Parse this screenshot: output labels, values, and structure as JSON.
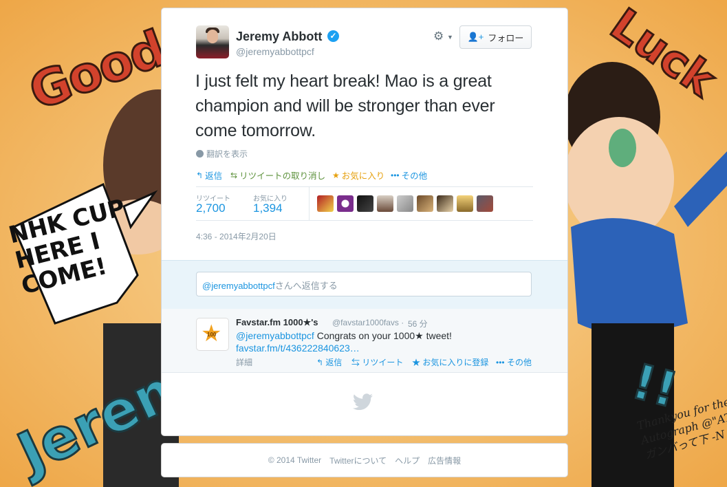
{
  "tweet": {
    "author_name": "Jeremy Abbott",
    "author_handle": "@jeremyabbottpcf",
    "follow_label": "フォロー",
    "text": "I just felt my heart break! Mao is a great champion and will be stronger than ever come tomorrow.",
    "translate_label": "翻訳を表示",
    "actions": {
      "reply": "返信",
      "retweet_undo": "リツイートの取り消し",
      "favorite": "お気に入り",
      "more": "その他"
    },
    "stats": {
      "retweets_label": "リツイート",
      "retweets_value": "2,700",
      "favorites_label": "お気に入り",
      "favorites_value": "1,394"
    },
    "timestamp": "4:36 - 2014年2月20日"
  },
  "reply_box": {
    "mention": "@jeremyabbottpcf",
    "suffix": "さんへ返信する"
  },
  "reply_tweet": {
    "author_name": "Favstar.fm 1000★'s",
    "author_handle": "@favstar1000favs",
    "separator": "·",
    "time": "56 分",
    "avatar_number": "100",
    "mention": "@jeremyabbottpcf",
    "body_text": " Congrats on your 1000★ tweet!",
    "link": "favstar.fm/t/436222840623…",
    "details": "詳細",
    "actions": {
      "reply": "返信",
      "retweet": "リツイート",
      "favorite": "お気に入りに登録",
      "more": "その他"
    }
  },
  "footer": {
    "copyright": "© 2014 Twitter",
    "about": "Twitterについて",
    "help": "ヘルプ",
    "ads": "広告情報"
  },
  "background_art": {
    "good": "Good",
    "luck": "Luck",
    "jeremy": "Jerem",
    "speech": "NHK CUP HERE I COME!",
    "exclaim": "!!",
    "autograph": "Thankyou for the Autograph @\"AT ガンバって下 -N"
  },
  "colors": {
    "accent": "#1b95e0",
    "retweet_green": "#5c913b",
    "favorite_gold": "#e6a110",
    "verified": "#1da1f2",
    "background": "#f2b85a"
  },
  "icons": {
    "verified": "verified-badge-icon",
    "gear": "gear-icon",
    "follow": "add-user-icon",
    "globe": "globe-icon",
    "reply": "reply-icon",
    "retweet": "retweet-icon",
    "favorite": "star-icon",
    "more": "more-dots-icon",
    "bird": "twitter-bird-icon"
  }
}
